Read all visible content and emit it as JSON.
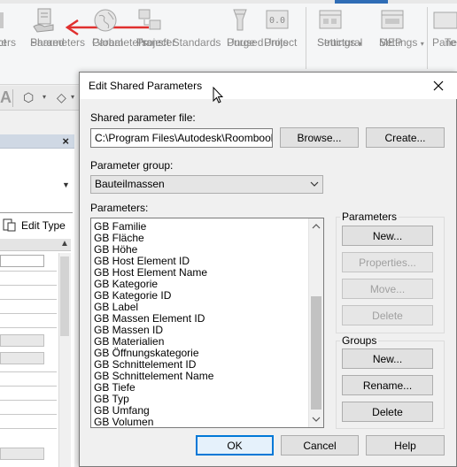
{
  "ribbon": {
    "items": [
      {
        "label1": "ct",
        "label2": "ters"
      },
      {
        "label1": "Shared",
        "label2": "Parameters"
      },
      {
        "label1": "Global",
        "label2": "Parameters"
      },
      {
        "label1": "Transfer",
        "label2": "Project Standards"
      },
      {
        "label1": "Purge",
        "label2": "Unused"
      },
      {
        "label1": "Project",
        "label2": "Units"
      },
      {
        "label1": "Structural",
        "label2": "Settings"
      },
      {
        "label1": "MEP",
        "label2": "Settings"
      },
      {
        "label1": "Pane",
        "label2": "Te"
      }
    ],
    "caret": "▾",
    "annotation_color": "#e0302f"
  },
  "qat": {
    "a_glyph": "A",
    "dropdown": "▾"
  },
  "properties": {
    "close": "×",
    "edit_type": "Edit Type",
    "header_caret": "▲"
  },
  "dialog": {
    "title": "Edit Shared Parameters",
    "shared_file_label": "Shared parameter file:",
    "shared_file_value": "C:\\Program Files\\Autodesk\\Roombook Ar",
    "browse": "Browse...",
    "create": "Create...",
    "group_label": "Parameter group:",
    "group_value": "Bauteilmassen",
    "params_label": "Parameters:",
    "parameters": [
      "GB Familie",
      "GB Fläche",
      "GB Höhe",
      "GB Host Element ID",
      "GB Host Element Name",
      "GB Kategorie",
      "GB Kategorie ID",
      "GB Label",
      "GB Massen Element ID",
      "GB Massen ID",
      "GB Materialien",
      "GB Öffnungskategorie",
      "GB Schnittelement ID",
      "GB Schnittelement Name",
      "GB Tiefe",
      "GB Typ",
      "GB Umfang",
      "GB Volumen"
    ],
    "parameters_group": {
      "title": "Parameters",
      "new": "New...",
      "properties": "Properties...",
      "move": "Move...",
      "delete": "Delete"
    },
    "groups_group": {
      "title": "Groups",
      "new": "New...",
      "rename": "Rename...",
      "delete": "Delete"
    },
    "ok": "OK",
    "cancel": "Cancel",
    "help": "Help"
  }
}
